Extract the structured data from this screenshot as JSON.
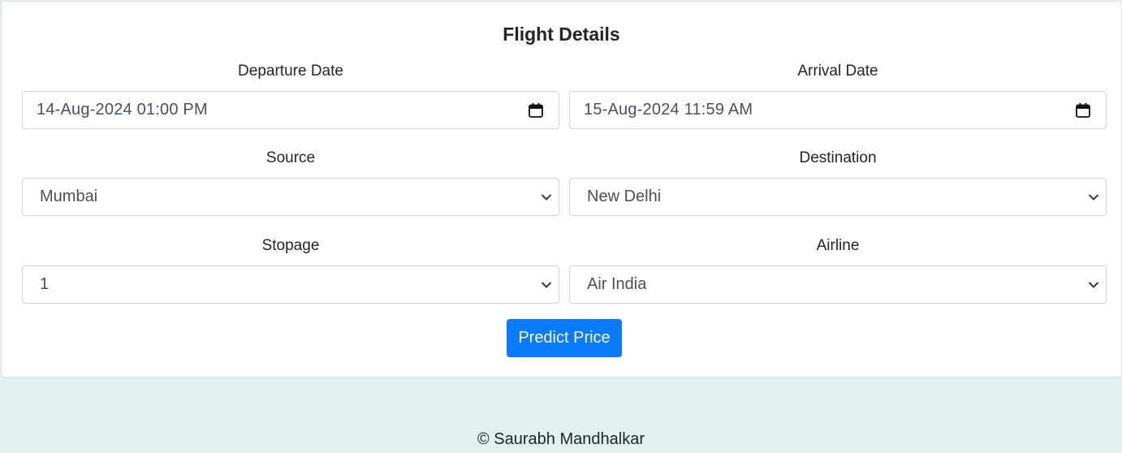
{
  "form": {
    "title": "Flight Details",
    "departure": {
      "label": "Departure Date",
      "value": "14-Aug-2024 01:00 PM"
    },
    "arrival": {
      "label": "Arrival Date",
      "value": "15-Aug-2024 11:59 AM"
    },
    "source": {
      "label": "Source",
      "value": "Mumbai"
    },
    "destination": {
      "label": "Destination",
      "value": "New Delhi"
    },
    "stopage": {
      "label": "Stopage",
      "value": "1"
    },
    "airline": {
      "label": "Airline",
      "value": "Air India"
    },
    "submit_label": "Predict Price"
  },
  "footer": {
    "text": "© Saurabh Mandhalkar"
  },
  "colors": {
    "primary": "#0a7bff",
    "page_background": "#e0f1f1",
    "card_background": "#ffffff"
  },
  "icons": {
    "date_picker": "calendar-icon",
    "select_arrow": "chevron-down-icon"
  }
}
